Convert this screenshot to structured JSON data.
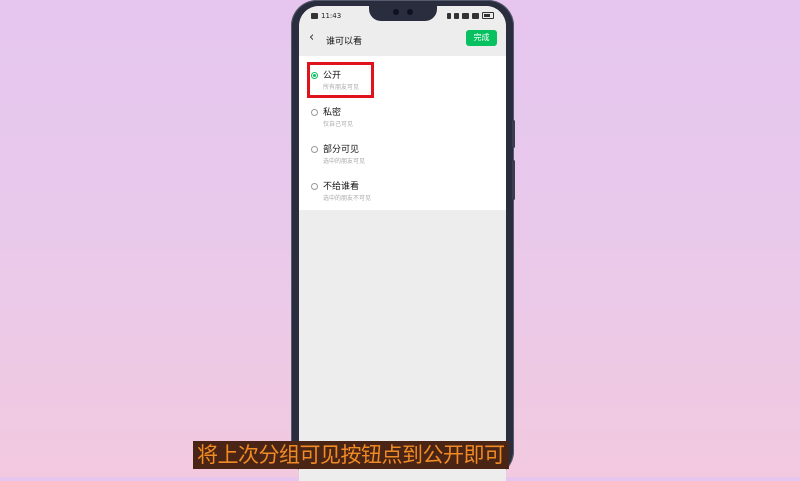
{
  "status_bar": {
    "time": "11:43"
  },
  "nav": {
    "title": "谁可以看",
    "done_label": "完成"
  },
  "options": [
    {
      "label": "公开",
      "sub": "所有朋友可见",
      "checked": true
    },
    {
      "label": "私密",
      "sub": "仅自己可见",
      "checked": false
    },
    {
      "label": "部分可见",
      "sub": "选中的朋友可见",
      "checked": false
    },
    {
      "label": "不给谁看",
      "sub": "选中的朋友不可见",
      "checked": false
    }
  ],
  "caption": "将上次分组可见按钮点到公开即可",
  "colors": {
    "accent": "#07c160",
    "highlight": "#e0121c",
    "caption_text": "#f08a24",
    "caption_bg": "#4a2414"
  }
}
